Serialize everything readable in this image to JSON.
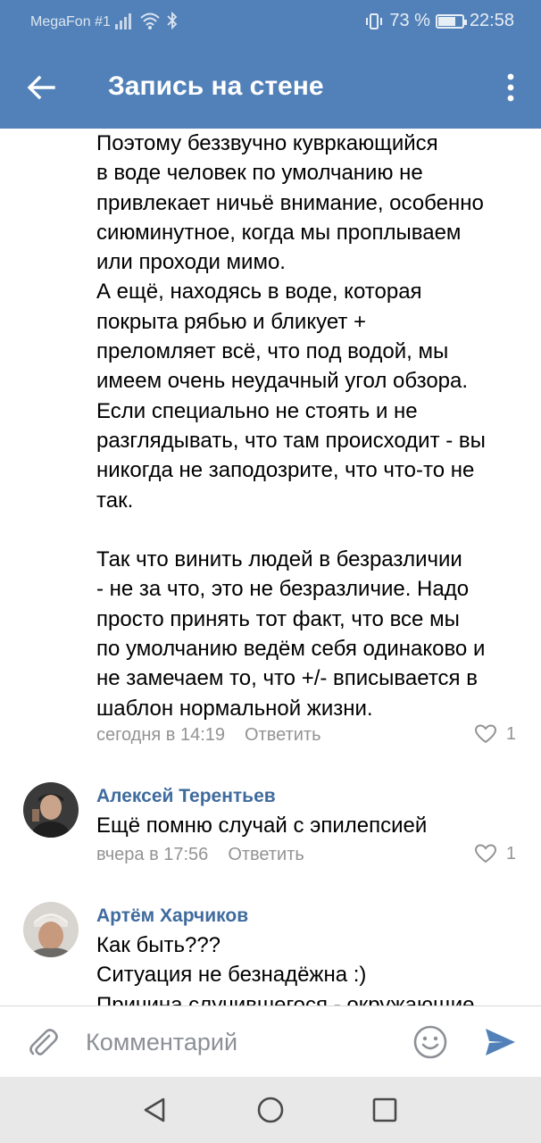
{
  "status_bar": {
    "carrier": "MegaFon #1",
    "battery_percent": "73 %",
    "battery_level": 0.73,
    "time": "22:58",
    "icons": [
      "signal-icon",
      "wifi-icon",
      "bluetooth-icon",
      "vibrate-icon",
      "battery-icon"
    ]
  },
  "header": {
    "title": "Запись на стене",
    "back_icon": "arrow-left-icon",
    "more_icon": "more-vertical-icon"
  },
  "comments": [
    {
      "text": "Поэтому беззвучно кувркающийся\nв воде человек по умолчанию не\nпривлекает ничьё внимание, особенно\nсиюминутное, когда мы проплываем\nили проходи мимо.\nА ещё, находясь в воде, которая\nпокрыта рябью и бликует +\nпреломляет всё, что под водой, мы\nимеем очень неудачный угол обзора.\nЕсли специально не стоять и не\nразглядывать, что там происходит - вы\nникогда не заподозрите, что что-то не\nтак.\n\nТак что винить людей в безразличии\n- не за что, это не безразличие. Надо\nпросто принять тот факт, что все мы\nпо умолчанию ведём себя одинаково и\nне замечаем то, что +/- вписывается в\nшаблон нормальной жизни.",
      "time": "сегодня в 14:19",
      "reply_label": "Ответить",
      "likes": "1"
    },
    {
      "author": "Алексей Терентьев",
      "text": "Ещё помню случай с эпилепсией",
      "time": "вчера в 17:56",
      "reply_label": "Ответить",
      "likes": "1"
    },
    {
      "author": "Артём Харчиков",
      "text": "Как быть???\nСитуация не безнадёжна :)\nПричина случившегося - окружающие"
    }
  ],
  "comment_input": {
    "placeholder": "Комментарий"
  },
  "colors": {
    "header_bg": "#5181b8",
    "author_name": "#3f6b9e",
    "meta": "#939393",
    "send": "#5181b8"
  }
}
